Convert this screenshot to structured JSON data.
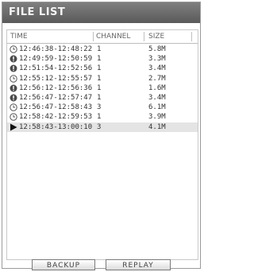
{
  "panel": {
    "title": "FILE LIST"
  },
  "list": {
    "columns": {
      "time": "TIME",
      "channel": "CHANNEL",
      "size": "SIZE"
    },
    "rows": [
      {
        "icon": "clock-icon",
        "time": "12:46:38-12:48:22",
        "channel": "1",
        "size": "5.8M"
      },
      {
        "icon": "alarm-icon",
        "time": "12:49:59-12:50:59",
        "channel": "1",
        "size": "3.3M"
      },
      {
        "icon": "alarm-icon",
        "time": "12:51:54-12:52:56",
        "channel": "1",
        "size": "3.4M"
      },
      {
        "icon": "clock-icon",
        "time": "12:55:12-12:55:57",
        "channel": "1",
        "size": "2.7M"
      },
      {
        "icon": "alarm-icon",
        "time": "12:56:12-12:56:36",
        "channel": "1",
        "size": "1.6M"
      },
      {
        "icon": "alarm-icon",
        "time": "12:56:47-12:57:47",
        "channel": "1",
        "size": "3.4M"
      },
      {
        "icon": "clock-icon",
        "time": "12:56:47-12:58:43",
        "channel": "3",
        "size": "6.1M"
      },
      {
        "icon": "clock-icon",
        "time": "12:58:42-12:59:53",
        "channel": "1",
        "size": "3.9M"
      },
      {
        "icon": "play-arrow-icon",
        "time": "12:58:43-13:00:10",
        "channel": "3",
        "size": "4.1M",
        "selected": true
      }
    ]
  },
  "buttons": {
    "backup": "BACKUP",
    "replay": "REPLAY"
  }
}
